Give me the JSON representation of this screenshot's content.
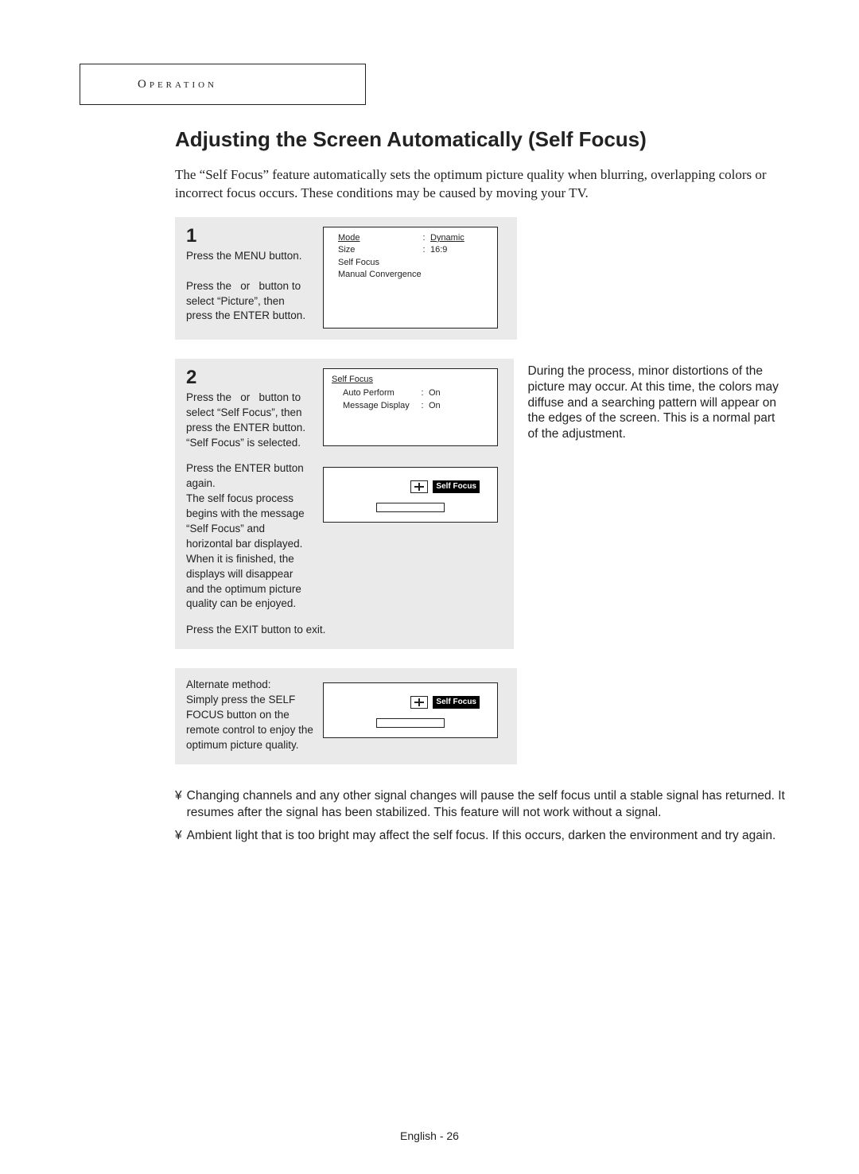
{
  "section_tab": "Operation",
  "title": "Adjusting the Screen Automatically (Self Focus)",
  "intro": "The “Self Focus” feature automatically sets the optimum picture quality when blurring, overlapping colors or incorrect focus occurs. These conditions may be caused by moving your TV.",
  "steps": {
    "one": {
      "num": "1",
      "text": "Press the MENU button.\n\nPress the   or   button to select “Picture”, then press the ENTER button."
    },
    "two": {
      "num": "2",
      "text_a": "Press the   or   button to select “Self Focus”, then press the ENTER button. “Self Focus” is selected.",
      "text_b": "Press the ENTER button again.\nThe self focus process begins with the message “Self Focus” and horizontal bar displayed.\nWhen it is finished, the displays will disappear and the optimum picture quality can be enjoyed.",
      "text_c": "Press the EXIT button to exit."
    },
    "alt": {
      "text": "Alternate method:\nSimply press the SELF FOCUS button on the remote control to enjoy the optimum picture quality."
    }
  },
  "side_note": "During the process, minor distortions of the picture may occur. At this time, the colors may diffuse and a searching pattern will appear on the edges of the screen. This is a normal part of the adjustment.",
  "osd": {
    "picture_menu": {
      "rows": [
        {
          "label": "Mode",
          "value": "Dynamic",
          "underlined": true
        },
        {
          "label": "Size",
          "value": "16:9"
        },
        {
          "label": "Self Focus",
          "value": ""
        },
        {
          "label": "Manual Convergence",
          "value": ""
        }
      ]
    },
    "self_focus_menu": {
      "header": "Self Focus",
      "rows": [
        {
          "label": "Auto Perform",
          "value": "On"
        },
        {
          "label": "Message Display",
          "value": "On"
        }
      ]
    },
    "self_focus_label": "Self Focus"
  },
  "notes": {
    "bullet": "¥",
    "n1": "Changing channels and any other signal changes will pause the self focus until a stable signal has returned. It resumes after the signal has been stabilized. This feature will not work without a signal.",
    "n2": "Ambient light that is too bright may affect the self focus. If this occurs, darken the environment and try again."
  },
  "page_footer": "English - 26"
}
